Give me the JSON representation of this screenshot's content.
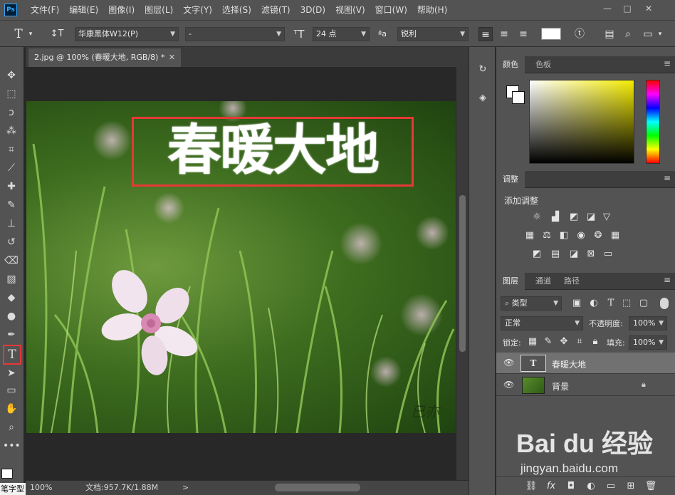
{
  "app": {
    "logo": "Ps"
  },
  "menu": [
    "文件(F)",
    "编辑(E)",
    "图像(I)",
    "图层(L)",
    "文字(Y)",
    "选择(S)",
    "滤镜(T)",
    "3D(D)",
    "视图(V)",
    "窗口(W)",
    "帮助(H)"
  ],
  "window_controls": {
    "minimize": "—",
    "restore": "□",
    "close": "✕"
  },
  "options": {
    "font_family": "华康黑体W12(P)",
    "font_style": "-",
    "font_size": "24 点",
    "antialias": "锐利",
    "text_color": "#ffffff"
  },
  "document": {
    "tab_title": "2.jpg @ 100% (春暖大地, RGB/8) *",
    "tab_close": "✕",
    "headline": "春暖大地",
    "watermark": "已亦"
  },
  "status": {
    "zoom": "100%",
    "doc_size": "文档:957.7K/1.88M"
  },
  "color_panel": {
    "tabs": [
      "颜色",
      "色板"
    ],
    "fg_color": "#ffffff",
    "bg_color": "#ffffff"
  },
  "adjust_panel": {
    "tab": "调整",
    "title": "添加调整"
  },
  "layers_panel": {
    "tabs": [
      "图层",
      "通道",
      "路径"
    ],
    "filter": "类型",
    "blend_mode": "正常",
    "opacity_label": "不透明度:",
    "opacity": "100%",
    "lock_label": "锁定:",
    "fill_label": "填充:",
    "fill": "100%",
    "layers": [
      {
        "name": "春暖大地",
        "type": "text",
        "thumb": "T",
        "selected": true
      },
      {
        "name": "背景",
        "type": "image",
        "locked": true,
        "selected": false
      }
    ]
  },
  "bottom_left": {
    "label": "笔字型"
  },
  "footer_watermark": {
    "line1": "Bai du 经验",
    "line2": "jingyan.baidu.com"
  }
}
